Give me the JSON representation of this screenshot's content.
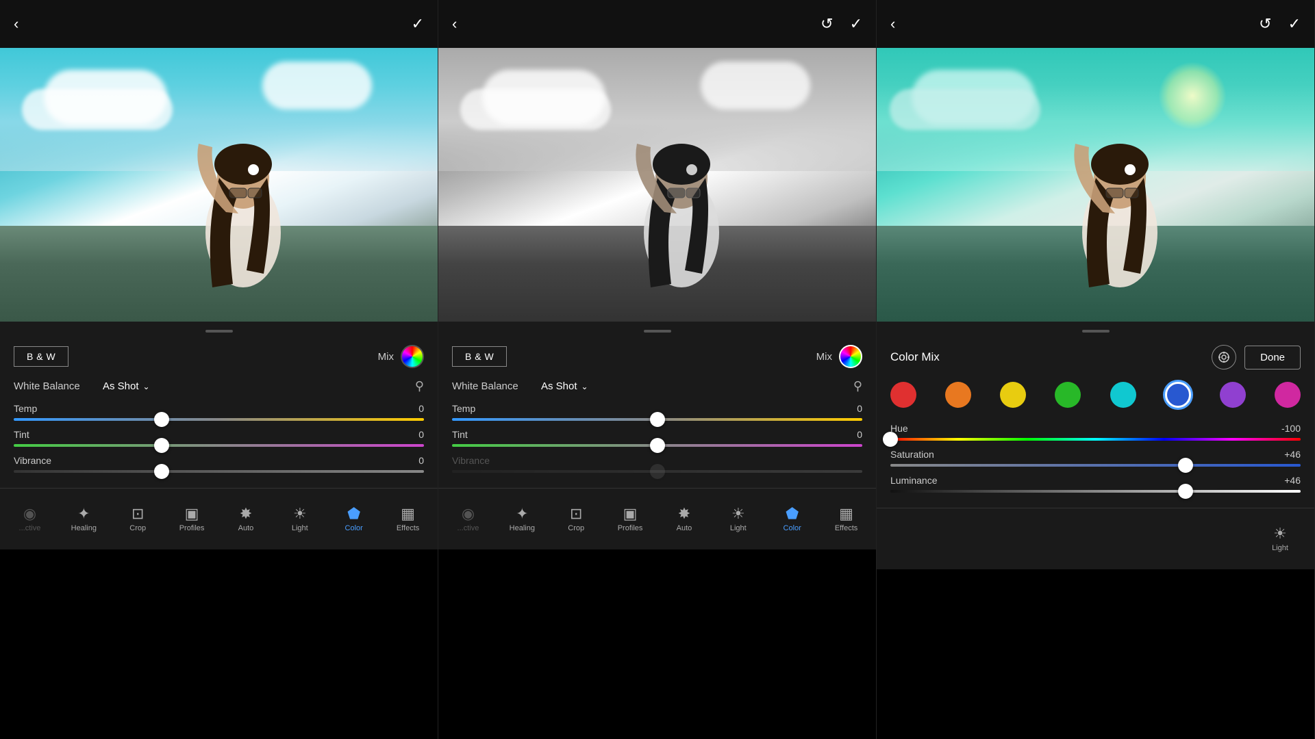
{
  "panels": [
    {
      "id": "panel1",
      "top_bar": {
        "back_label": "‹",
        "check_label": "✓"
      },
      "photo_type": "color",
      "controls": {
        "bw_btn": "B & W",
        "mix_label": "Mix",
        "white_balance_label": "White Balance",
        "white_balance_value": "As Shot",
        "temp_label": "Temp",
        "temp_value": "0",
        "tint_label": "Tint",
        "tint_value": "0",
        "vibrance_label": "Vibrance",
        "vibrance_value": "0",
        "temp_thumb_pct": 36,
        "tint_thumb_pct": 36,
        "vibrance_thumb_pct": 36
      },
      "nav": {
        "items": [
          {
            "label": "...ctive",
            "icon": "◉",
            "active": false,
            "partial": true
          },
          {
            "label": "Healing",
            "icon": "✦",
            "active": false
          },
          {
            "label": "Crop",
            "icon": "⊡",
            "active": false
          },
          {
            "label": "Profiles",
            "icon": "▣",
            "active": false
          },
          {
            "label": "Auto",
            "icon": "✸",
            "active": false
          },
          {
            "label": "Light",
            "icon": "☀",
            "active": false
          },
          {
            "label": "Color",
            "icon": "⬟",
            "active": true
          },
          {
            "label": "Effects",
            "icon": "▦",
            "active": false
          }
        ]
      }
    },
    {
      "id": "panel2",
      "top_bar": {
        "back_label": "‹",
        "undo_label": "↺",
        "check_label": "✓"
      },
      "photo_type": "bw",
      "controls": {
        "bw_btn": "B & W",
        "mix_label": "Mix",
        "white_balance_label": "White Balance",
        "white_balance_value": "As Shot",
        "temp_label": "Temp",
        "temp_value": "0",
        "tint_label": "Tint",
        "tint_value": "0",
        "vibrance_label": "Vibrance",
        "vibrance_value": "",
        "vibrance_disabled": true,
        "temp_thumb_pct": 50,
        "tint_thumb_pct": 50,
        "vibrance_thumb_pct": 50
      },
      "nav": {
        "items": [
          {
            "label": "...ctive",
            "icon": "◉",
            "active": false,
            "partial": true
          },
          {
            "label": "Healing",
            "icon": "✦",
            "active": false
          },
          {
            "label": "Crop",
            "icon": "⊡",
            "active": false
          },
          {
            "label": "Profiles",
            "icon": "▣",
            "active": false
          },
          {
            "label": "Auto",
            "icon": "✸",
            "active": false
          },
          {
            "label": "Light",
            "icon": "☀",
            "active": false
          },
          {
            "label": "Color",
            "icon": "⬟",
            "active": true
          },
          {
            "label": "Effects",
            "icon": "▦",
            "active": false
          }
        ]
      }
    },
    {
      "id": "panel3",
      "top_bar": {
        "back_label": "‹",
        "undo_label": "↺",
        "check_label": "✓"
      },
      "photo_type": "color_mix",
      "color_mix": {
        "title": "Color Mix",
        "done_label": "Done",
        "swatches": [
          {
            "color": "red",
            "class": "swatch-red"
          },
          {
            "color": "orange",
            "class": "swatch-orange"
          },
          {
            "color": "yellow",
            "class": "swatch-yellow"
          },
          {
            "color": "green",
            "class": "swatch-green"
          },
          {
            "color": "cyan",
            "class": "swatch-cyan"
          },
          {
            "color": "blue",
            "class": "swatch-blue",
            "selected": true
          },
          {
            "color": "purple",
            "class": "swatch-purple"
          },
          {
            "color": "magenta",
            "class": "swatch-magenta"
          }
        ],
        "hue_label": "Hue",
        "hue_value": "-100",
        "hue_thumb_pct": 0,
        "saturation_label": "Saturation",
        "saturation_value": "+46",
        "saturation_thumb_pct": 72,
        "luminance_label": "Luminance",
        "luminance_value": "+46",
        "luminance_thumb_pct": 72
      },
      "nav": {
        "items": [
          {
            "label": "Light",
            "icon": "☀",
            "active": false
          }
        ]
      }
    }
  ]
}
